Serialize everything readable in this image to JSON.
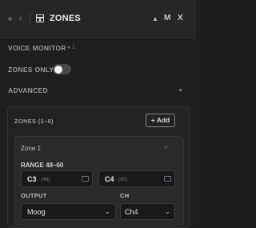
{
  "header": {
    "title": "ZONES",
    "add_symbol": "+",
    "up_symbol": "▲",
    "m_label": "M",
    "x_label": "X"
  },
  "voice_monitor": {
    "label": "VOICE MONITOR",
    "value": "1"
  },
  "zones_only": {
    "label": "ZONES ONLY",
    "enabled": false
  },
  "advanced": {
    "label": "ADVANCED",
    "chevron": "▼"
  },
  "zones": {
    "heading": "ZONES (1–8)",
    "add_button": "+ Add",
    "items": [
      {
        "name": "Zone 1",
        "close": "✕",
        "range_label": "RANGE 48–60",
        "low_note": "C3",
        "low_value": "(48)",
        "high_note": "C4",
        "high_value": "(60)",
        "output_label": "OUTPUT",
        "output_value": "Moog",
        "channel_label": "CH",
        "channel_value": "Ch4"
      }
    ]
  },
  "colors": {
    "background": "#1e1e20",
    "header": "#262628",
    "toggle_off": "#48484b"
  }
}
